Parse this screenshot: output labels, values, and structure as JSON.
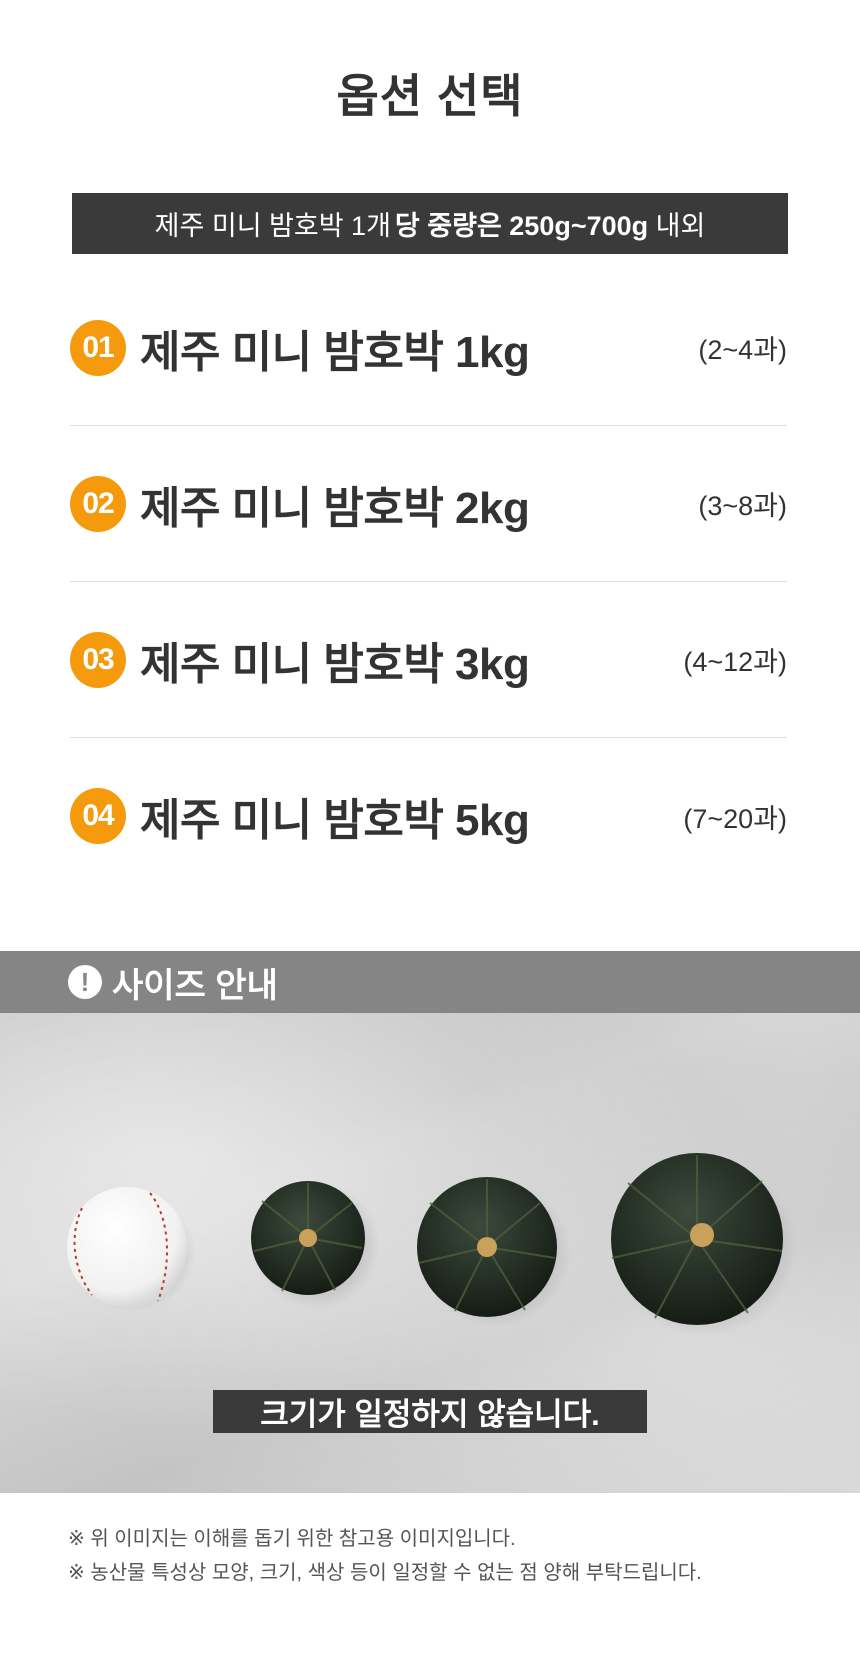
{
  "title": "옵션 선택",
  "banner": {
    "normal": "제주 미니 밤호박 1개",
    "bold": "당 중량은 250g~700g",
    "suffix": " 내외"
  },
  "options": [
    {
      "num": "01",
      "name": "제주 미니 밤호박 1kg",
      "count": "(2~4과)"
    },
    {
      "num": "02",
      "name": "제주 미니 밤호박 2kg",
      "count": "(3~8과)"
    },
    {
      "num": "03",
      "name": "제주 미니 밤호박 3kg",
      "count": "(4~12과)"
    },
    {
      "num": "04",
      "name": "제주 미니 밤호박 5kg",
      "count": "(7~20과)"
    }
  ],
  "size_guide": {
    "icon": "exclamation-circle-icon",
    "alert_glyph": "!",
    "label": "사이즈 안내",
    "caption": "크기가 일정하지 않습니다."
  },
  "notes": [
    "※ 위 이미지는 이해를 돕기 위한 참고용 이미지입니다.",
    "※ 농산물 특성상 모양, 크기, 색상 등이 일정할 수 없는 점 양해 부탁드립니다."
  ],
  "colors": {
    "accent": "#f59a0c",
    "dark_bar": "#3a3a3a",
    "gray_bar": "#858585"
  }
}
